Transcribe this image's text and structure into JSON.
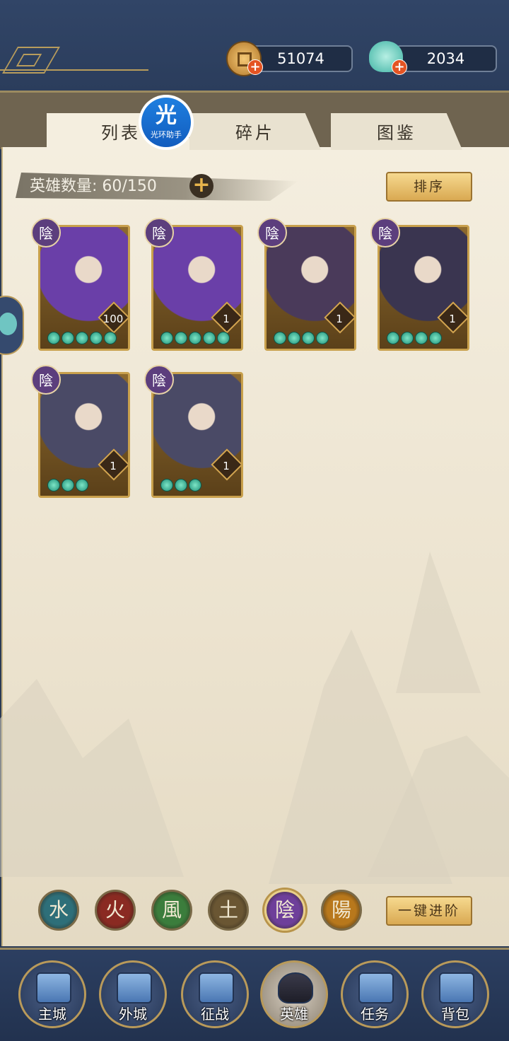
{
  "currency": {
    "gold": "51074",
    "jade": "2034"
  },
  "tabs": [
    {
      "label": "列表"
    },
    {
      "label": "碎片"
    },
    {
      "label": "图鉴"
    }
  ],
  "overlay_badge": {
    "big": "光",
    "small": "光环助手"
  },
  "hero_count": {
    "label": "英雄数量:",
    "value": "60/150"
  },
  "sort_button": "排序",
  "advance_button": "一键进阶",
  "heroes": [
    {
      "element": "陰",
      "level": "100",
      "stars": 5
    },
    {
      "element": "陰",
      "level": "1",
      "stars": 5
    },
    {
      "element": "陰",
      "level": "1",
      "stars": 4
    },
    {
      "element": "陰",
      "level": "1",
      "stars": 4
    },
    {
      "element": "陰",
      "level": "1",
      "stars": 3
    },
    {
      "element": "陰",
      "level": "1",
      "stars": 3
    }
  ],
  "element_filters": [
    {
      "glyph": "水",
      "color": "#2e6f79"
    },
    {
      "glyph": "火",
      "color": "#8a2a22"
    },
    {
      "glyph": "風",
      "color": "#3b7d3c"
    },
    {
      "glyph": "土",
      "color": "#6a5633"
    },
    {
      "glyph": "陰",
      "color": "#6e3f9a",
      "active": true
    },
    {
      "glyph": "陽",
      "color": "#b8781c"
    }
  ],
  "nav": [
    {
      "label": "主城"
    },
    {
      "label": "外城"
    },
    {
      "label": "征战"
    },
    {
      "label": "英雄",
      "active": true
    },
    {
      "label": "任务"
    },
    {
      "label": "背包"
    }
  ],
  "colors": {
    "panel_bg": "#f4eedf",
    "frame_gold": "#c8a04c",
    "top_bar": "#314567"
  }
}
